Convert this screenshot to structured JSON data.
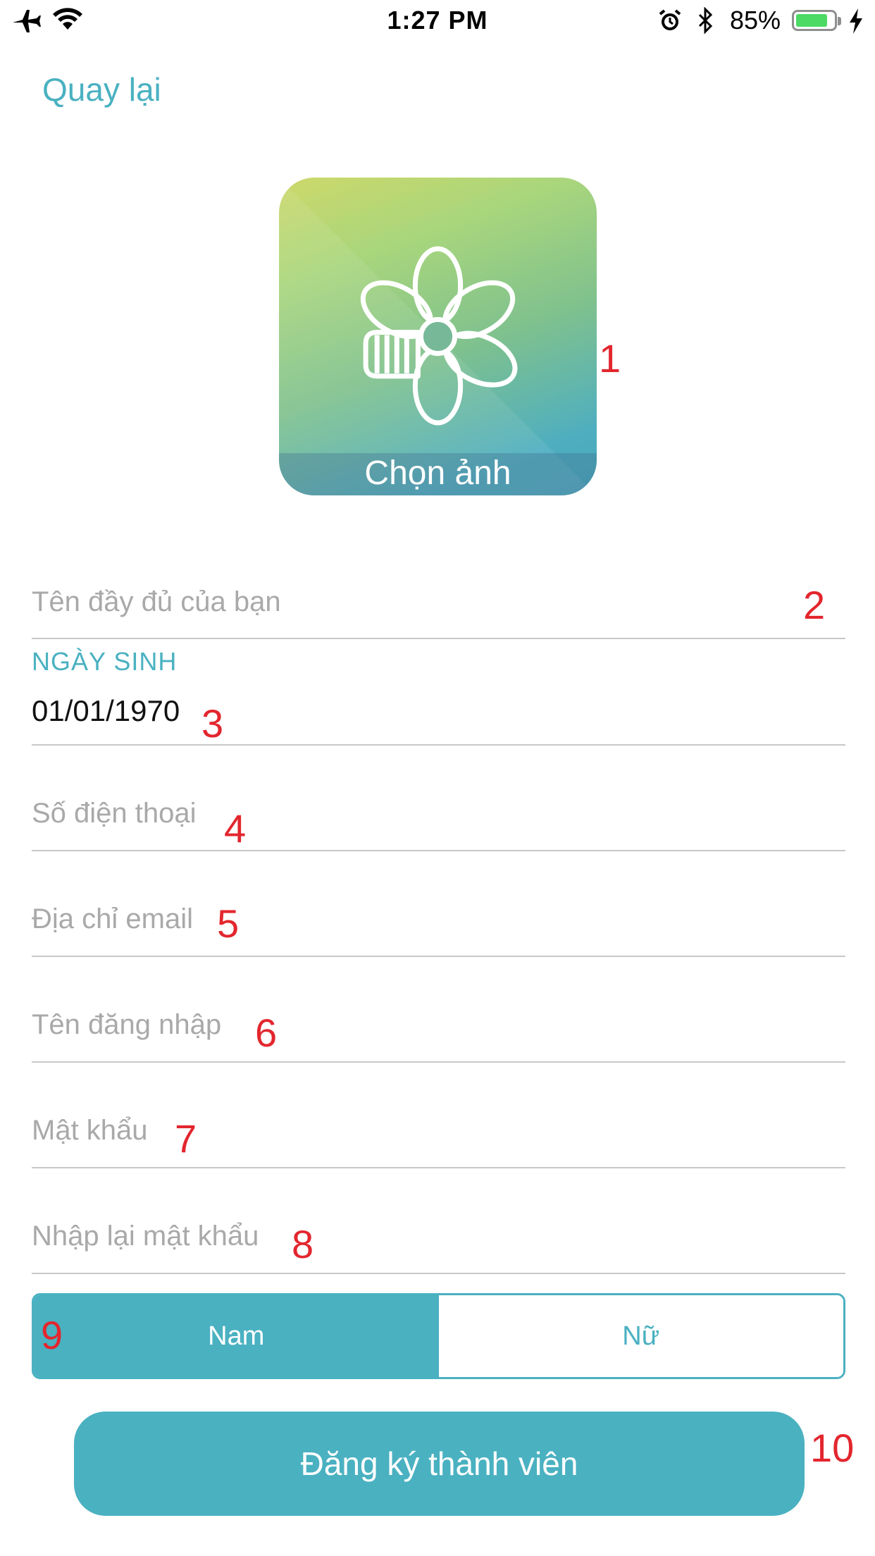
{
  "status_bar": {
    "time": "1:27 PM",
    "battery_percent": "85%",
    "battery_level": 0.85,
    "icons": [
      "airplane-icon",
      "wifi-icon",
      "alarm-icon",
      "bluetooth-icon",
      "battery-icon",
      "charging-bolt-icon"
    ]
  },
  "nav": {
    "back_label": "Quay lại"
  },
  "avatar": {
    "label": "Chọn ảnh",
    "icon": "flower-icon"
  },
  "form": {
    "fullname_placeholder": "Tên đầy đủ của bạn",
    "dob_label": "NGÀY SINH",
    "dob_value": "01/01/1970",
    "phone_placeholder": "Số điện thoại",
    "email_placeholder": "Địa chỉ email",
    "username_placeholder": "Tên đăng nhập",
    "password_placeholder": "Mật khẩu",
    "password_confirm_placeholder": "Nhập lại mật khẩu"
  },
  "gender": {
    "options": [
      "Nam",
      "Nữ"
    ],
    "selected": "Nam"
  },
  "register_button": {
    "label": "Đăng ký thành viên"
  },
  "annotations": {
    "n1": "1",
    "n2": "2",
    "n3": "3",
    "n4": "4",
    "n5": "5",
    "n6": "6",
    "n7": "7",
    "n8": "8",
    "n9": "9",
    "n10": "10"
  },
  "colors": {
    "accent": "#4ab1c1",
    "annotation_red": "#e3262e",
    "placeholder": "#a9a9a9",
    "divider": "#c8c8c8"
  }
}
